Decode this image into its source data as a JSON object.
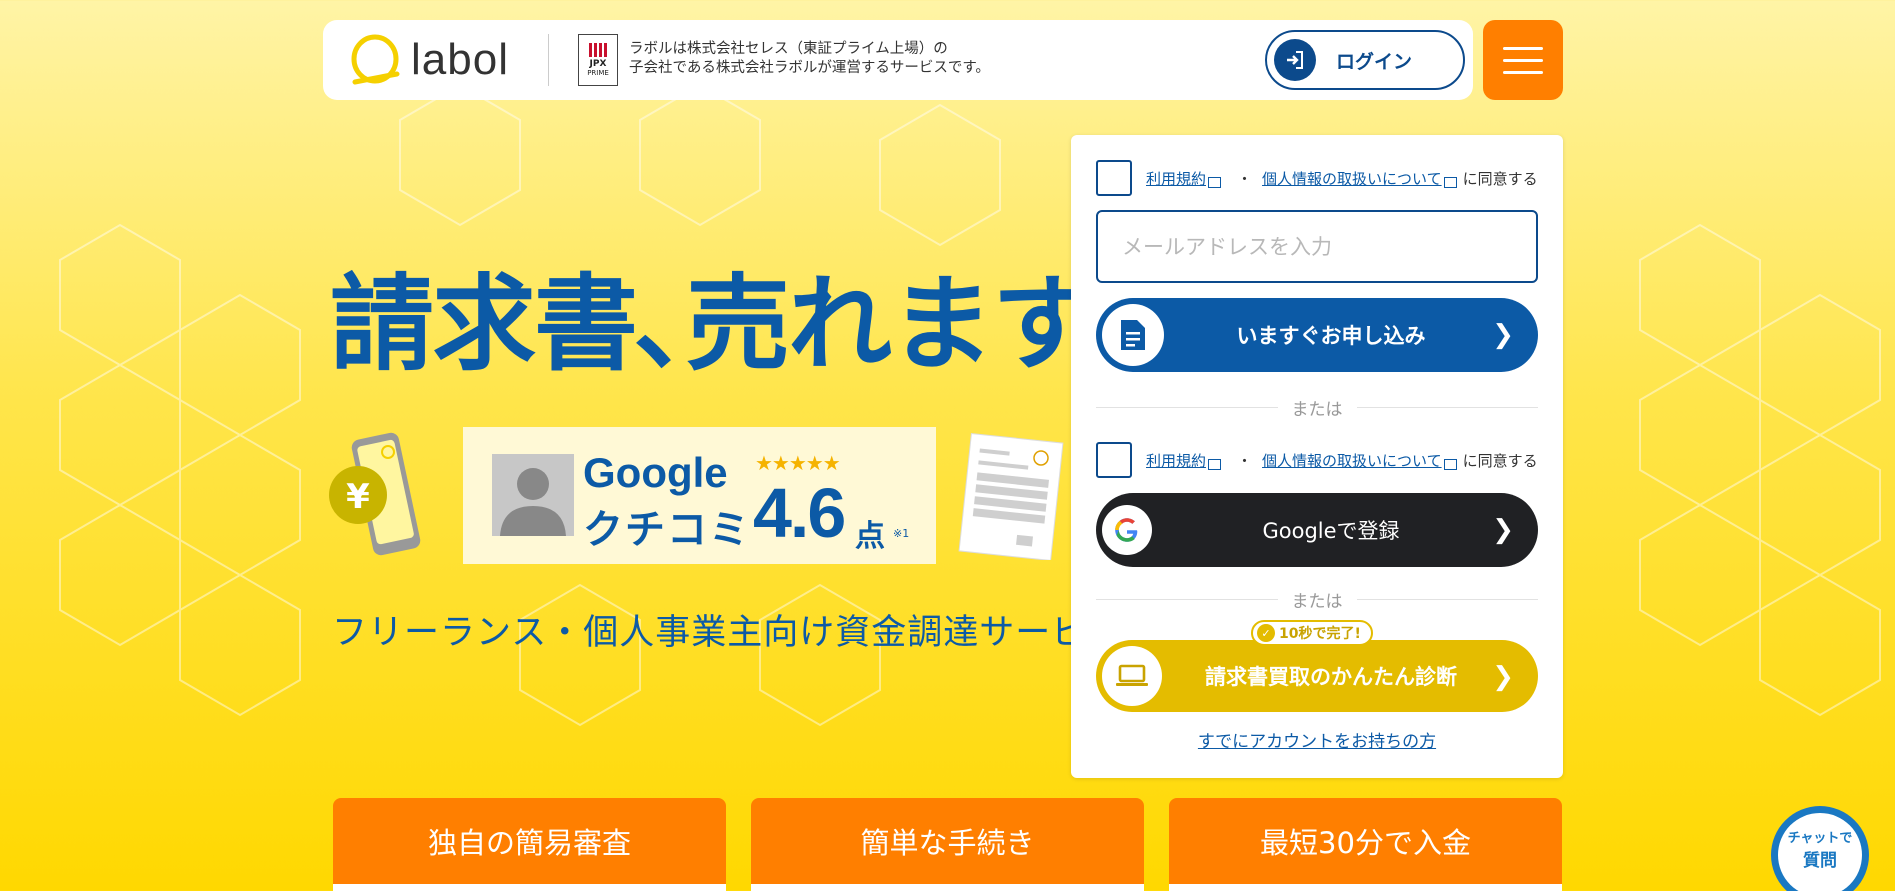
{
  "header": {
    "logo_text": "labol",
    "jpx_label": "JPX",
    "jpx_sub": "PRIME",
    "company_note_line1": "ラボルは株式会社セレス（東証プライム上場）の",
    "company_note_line2": "子会社である株式会社ラボルが運営するサービスです。",
    "login_label": "ログイン"
  },
  "hero": {
    "headline": "請求書､売れます",
    "review": {
      "google": "Google",
      "kuchikomi": "クチコミ",
      "stars": "★★★★★",
      "score": "4.6",
      "unit": "点",
      "note": "※1"
    },
    "subtitle": "フリーランス・個人事業主向け資金調達サービス"
  },
  "signup": {
    "terms_link": "利用規約",
    "privacy_link": "個人情報の取扱いについて",
    "dot": "・",
    "agree_suffix": "に同意する",
    "email_placeholder": "メールアドレスを入力",
    "apply_label": "いますぐお申し込み",
    "or_label": "または",
    "google_label": "Googleで登録",
    "badge_label": "10秒で完了!",
    "diagnosis_label": "請求書買取のかんたん診断",
    "existing_account": "すでにアカウントをお持ちの方"
  },
  "features": [
    {
      "label": "独自の簡易審査"
    },
    {
      "label": "簡単な手続き"
    },
    {
      "label": "最短30分で入金"
    }
  ],
  "chat": {
    "line1": "チャットで",
    "line2": "質問"
  },
  "colors": {
    "brand_blue": "#0c5aa6",
    "accent_orange": "#ff7f00",
    "accent_yellow": "#e4bc00"
  }
}
